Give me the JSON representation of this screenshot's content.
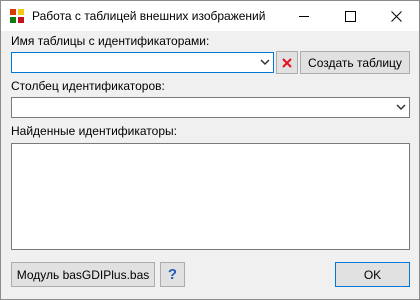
{
  "window": {
    "title": "Работа с таблицей внешних изображений"
  },
  "table_name": {
    "label": "Имя таблицы с идентификаторами:",
    "value": "",
    "create_button": "Создать таблицу"
  },
  "id_column": {
    "label": "Столбец идентификаторов:",
    "value": ""
  },
  "found_ids": {
    "label": "Найденные идентификаторы:",
    "items": []
  },
  "footer": {
    "module_button": "Модуль basGDIPlus.bas",
    "help_button": "?",
    "ok_button": "OK"
  },
  "colors": {
    "accent": "#0078d7",
    "clear_icon": "#e81123",
    "help_icon": "#1e5bb8"
  }
}
